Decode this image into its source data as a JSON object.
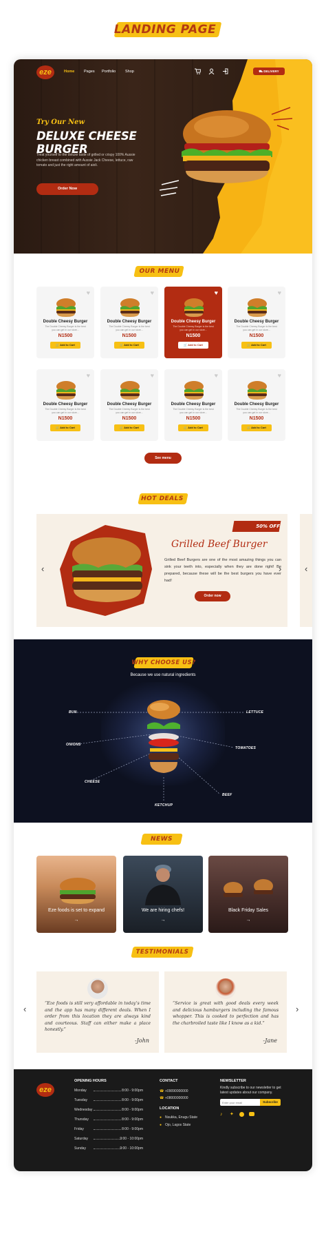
{
  "page_title": "LANDING PAGE",
  "nav": {
    "logo": "eze",
    "items": [
      "Home",
      "Pages",
      "Portfolio",
      "Shop"
    ],
    "delivery": "DELIVERY"
  },
  "hero": {
    "subtitle": "Try Our New",
    "title": "DELUXE CHEESE BURGER",
    "desc": "Treat yourself to the deluxe taste of grilled or crispy 100% Aussie chicken breast combined with Aussie Jack Cheese, lettuce, raw tomato and just the right amount of aioli.",
    "cta": "Order Now"
  },
  "menu": {
    "title": "OUR MENU",
    "see_menu": "See menu",
    "items": [
      {
        "name": "Double Cheesy Burger",
        "desc": "The Double Cheesy Burger is the best you can get in our store...",
        "price": "N1500",
        "button": "Add to Cart"
      },
      {
        "name": "Double Cheesy Burger",
        "desc": "The Double Cheesy Burger is the best you can get in our store...",
        "price": "N1500",
        "button": "Add to Cart"
      },
      {
        "name": "Double Cheesy Burger",
        "desc": "The Double Cheesy Burger is the best you can get in our store...",
        "price": "N1500",
        "button": "Add to Cart"
      },
      {
        "name": "Double Cheesy Burger",
        "desc": "The Double Cheesy Burger is the best you can get in our store...",
        "price": "N1500",
        "button": "Add to Cart"
      },
      {
        "name": "Double Cheesy Burger",
        "desc": "The Double Cheesy Burger is the best you can get in our store...",
        "price": "N1500",
        "button": "Add to Cart"
      },
      {
        "name": "Double Cheesy Burger",
        "desc": "The Double Cheesy Burger is the best you can get in our store...",
        "price": "N1500",
        "button": "Add to Cart"
      },
      {
        "name": "Double Cheesy Burger",
        "desc": "The Double Cheesy Burger is the best you can get in our store...",
        "price": "N1500",
        "button": "Add to Cart"
      },
      {
        "name": "Double Cheesy Burger",
        "desc": "The Double Cheesy Burger is the best you can get in our store...",
        "price": "N1500",
        "button": "Add to Cart"
      }
    ]
  },
  "deals": {
    "title": "HOT DEALS",
    "badge": "50% OFF",
    "name": "Grilled Beef Burger",
    "desc": "Grilled Beef Burgers are one of the most amazing things you can sink your teeth into, especially when they are done right! Be prepared, because these will be the best burgers you have ever had!",
    "cta": "Order now"
  },
  "why": {
    "title": "WHY CHOOSE US?",
    "subtitle": "Because we use natural ingredients",
    "ingredients": {
      "bun": "BUN",
      "lettuce": "LETTUCE",
      "onions": "ONIONS",
      "tomatoes": "TOMATOES",
      "cheese": "CHEESE",
      "beef": "BEEF",
      "ketchup": "KETCHUP"
    }
  },
  "news": {
    "title": "NEWS",
    "items": [
      {
        "caption": "Eze foods is set to expand"
      },
      {
        "caption": "We are hiring chefs!"
      },
      {
        "caption": "Black Friday Sales"
      }
    ]
  },
  "testimonials": {
    "title": "TESTIMONIALS",
    "items": [
      {
        "quote": "“Eze foods is still very affordable in today’s time and the app has many different deals. When I order from this location they are always kind and courteous. Staff can either make a place honestly.”",
        "author": "-John"
      },
      {
        "quote": "“Service is great with good deals every week and delicious hamburgers including the famous whopper. This is cooked to perfection and has the charbroiled taste like I know as a kid.”",
        "author": "-Jane"
      }
    ]
  },
  "footer": {
    "logo": "eze",
    "hours_title": "OPENING HOURS",
    "hours": [
      {
        "day": "Monday",
        "time": "8:00 - 9:00pm"
      },
      {
        "day": "Tuesday",
        "time": "8:00 - 9:00pm"
      },
      {
        "day": "Wednesday",
        "time": "8:00 - 9:00pm"
      },
      {
        "day": "Thursday",
        "time": "8:00 - 9:00pm"
      },
      {
        "day": "Friday",
        "time": "8:00 - 9:00pm"
      },
      {
        "day": "Saturday",
        "time": "9:00 - 10:00pm"
      },
      {
        "day": "Sunday",
        "time": "9:00 - 10:00pm"
      }
    ],
    "contact_title": "CONTACT",
    "phones": [
      "+09090000000",
      "+08000000000"
    ],
    "location_title": "LOCATION",
    "locations": [
      "Nsukka, Enugu State",
      "Ojo, Lagos State"
    ],
    "newsletter_title": "NEWSLETTER",
    "newsletter_desc": "Kindly subscribe to our newsletter to get latest updates about our company.",
    "email_placeholder": "Enter your email",
    "subscribe": "Subscribe"
  },
  "colors": {
    "brand_red": "#b22c12",
    "brand_yellow": "#f7c014",
    "dark_navy": "#0d1120",
    "footer_black": "#1a1a1a"
  }
}
